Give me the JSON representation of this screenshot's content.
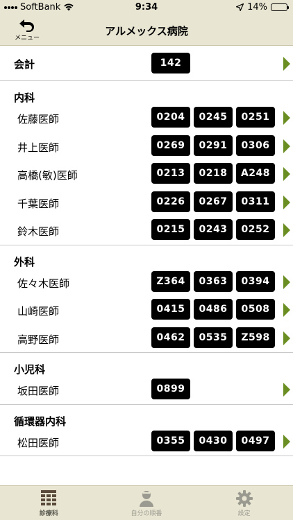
{
  "status_bar": {
    "carrier": "SoftBank",
    "time": "9:34",
    "battery": "14%",
    "battery_level": 0.14
  },
  "nav": {
    "back_label": "メニュー",
    "title": "アルメックス病院"
  },
  "summary": {
    "label": "会計",
    "numbers": [
      "142"
    ]
  },
  "departments": [
    {
      "name": "内科",
      "doctors": [
        {
          "name": "佐藤医師",
          "numbers": [
            "0204",
            "0245",
            "0251"
          ]
        },
        {
          "name": "井上医師",
          "numbers": [
            "0269",
            "0291",
            "0306"
          ]
        },
        {
          "name": "高橋(敏)医師",
          "numbers": [
            "0213",
            "0218",
            "A248"
          ]
        },
        {
          "name": "千葉医師",
          "numbers": [
            "0226",
            "0267",
            "0311"
          ]
        },
        {
          "name": "鈴木医師",
          "numbers": [
            "0215",
            "0243",
            "0252"
          ]
        }
      ]
    },
    {
      "name": "外科",
      "doctors": [
        {
          "name": "佐々木医師",
          "numbers": [
            "Z364",
            "0363",
            "0394"
          ]
        },
        {
          "name": "山崎医師",
          "numbers": [
            "0415",
            "0486",
            "0508"
          ]
        },
        {
          "name": "高野医師",
          "numbers": [
            "0462",
            "0535",
            "Z598"
          ]
        }
      ]
    },
    {
      "name": "小児科",
      "doctors": [
        {
          "name": "坂田医師",
          "numbers": [
            "0899"
          ]
        }
      ]
    },
    {
      "name": "循環器内科",
      "doctors": [
        {
          "name": "松田医師",
          "numbers": [
            "0355",
            "0430",
            "0497"
          ]
        }
      ]
    }
  ],
  "tabs": [
    {
      "label": "診療科",
      "icon": "list-grid-icon",
      "active": true
    },
    {
      "label": "自分の順番",
      "icon": "person-icon",
      "active": false
    },
    {
      "label": "設定",
      "icon": "gear-icon",
      "active": false
    }
  ],
  "colors": {
    "bar_background": "#e8e5d2",
    "badge": "#000000",
    "arrow": "#6b8e23",
    "battery_low": "#e33b2f"
  }
}
